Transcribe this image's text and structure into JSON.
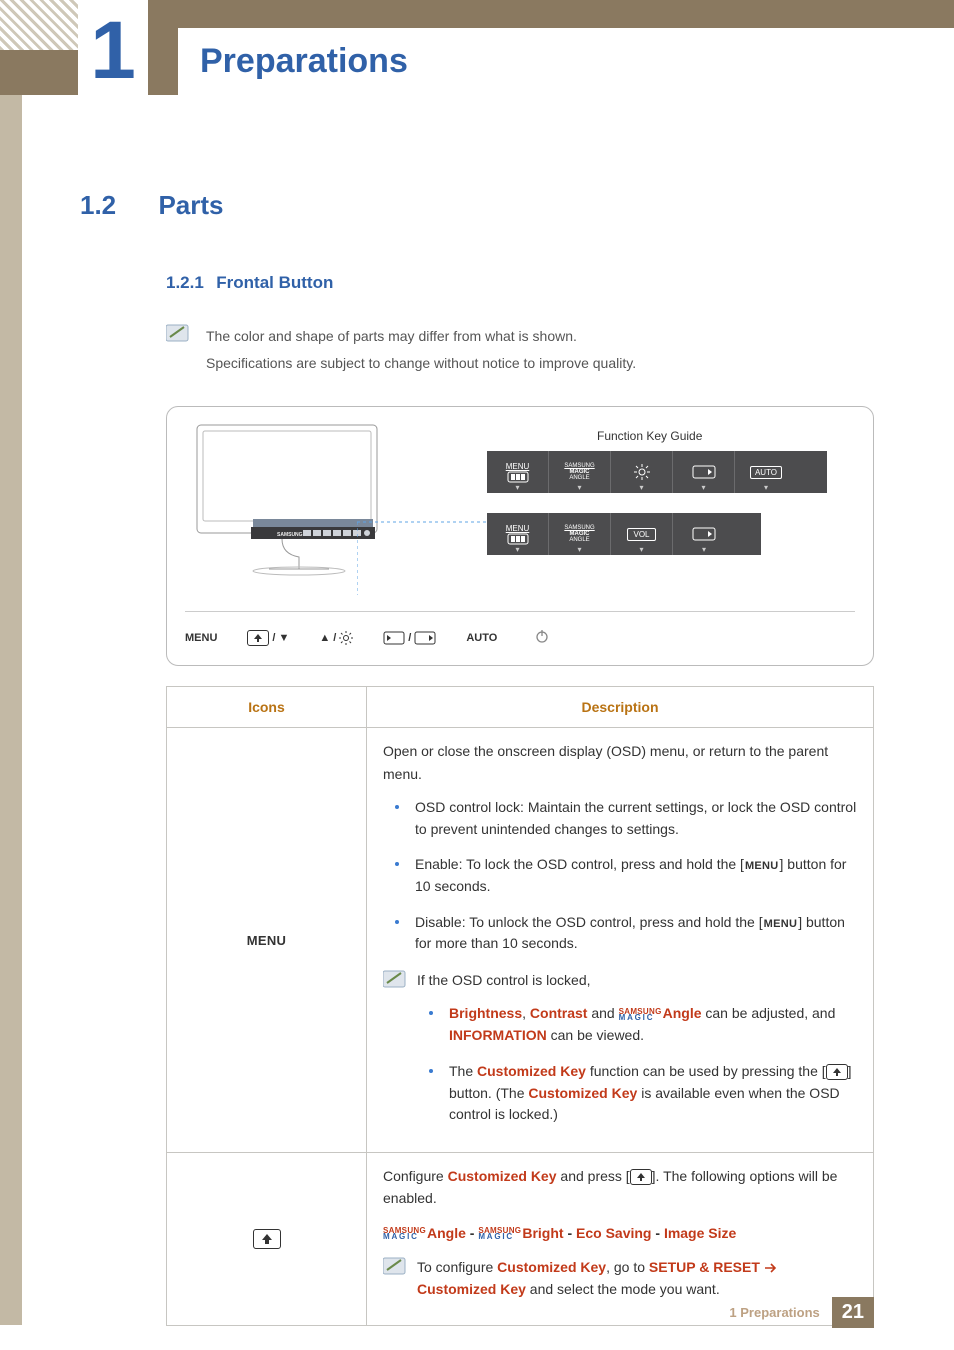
{
  "chapter": {
    "number": "1",
    "title": "Preparations"
  },
  "section": {
    "number": "1.2",
    "title": "Parts"
  },
  "subsection": {
    "number": "1.2.1",
    "title": "Frontal Button"
  },
  "note": {
    "line1": "The color and shape of parts may differ from what is shown.",
    "line2": "Specifications are subject to change without notice to improve quality."
  },
  "diagram": {
    "guide_label": "Function Key Guide",
    "row1": [
      "MENU",
      "SAMSUNG MAGIC ANGLE",
      "brightness",
      "source",
      "AUTO"
    ],
    "row2": [
      "MENU",
      "SAMSUNG MAGIC ANGLE",
      "VOL",
      "source"
    ],
    "buttons": {
      "b1": "MENU",
      "b5": "AUTO"
    }
  },
  "table": {
    "headers": {
      "icons": "Icons",
      "description": "Description"
    },
    "row_menu": {
      "icon_label": "MENU",
      "open": "Open or close the onscreen display (OSD) menu, or return to the parent menu.",
      "lock": "OSD control lock: Maintain the current settings, or lock the OSD control to prevent unintended changes to settings.",
      "enable_pre": "Enable: To lock the OSD control, press and hold the [",
      "enable_btn": "MENU",
      "enable_post": "] button for 10 seconds.",
      "disable_pre": "Disable: To unlock the OSD control, press and hold the [",
      "disable_btn": "MENU",
      "disable_post": "] button for more than 10 seconds.",
      "locked_intro": "If the OSD control is locked,",
      "locked_b1_a": "Brightness",
      "locked_b1_sep1": ", ",
      "locked_b1_b": "Contrast",
      "locked_b1_sep2": " and ",
      "locked_b1_c": "Angle",
      "locked_b1_tail": " can be adjusted, and ",
      "locked_b1_d": "INFORMATION",
      "locked_b1_end": " can be viewed.",
      "locked_b2_a": "The ",
      "locked_b2_b": "Customized Key",
      "locked_b2_c": " function can be used by pressing the [",
      "locked_b2_d": "] button. (The ",
      "locked_b2_e": "Customized Key",
      "locked_b2_f": " is available even when the OSD control is locked.)"
    },
    "row_custom": {
      "configure_a": "Configure ",
      "configure_b": "Customized Key",
      "configure_c": " and press [",
      "configure_d": "]. The following options will be enabled.",
      "opt1": "Angle",
      "optsep": " - ",
      "opt2": "Bright",
      "opt3": "Eco Saving",
      "opt4": "Image Size",
      "note_a": "To configure ",
      "note_b": "Customized Key",
      "note_c": ", go to ",
      "note_d": "SETUP & RESET",
      "note_e": "Customized Key",
      "note_f": " and select the mode you want."
    }
  },
  "footer": {
    "text": "1 Preparations",
    "page": "21"
  }
}
